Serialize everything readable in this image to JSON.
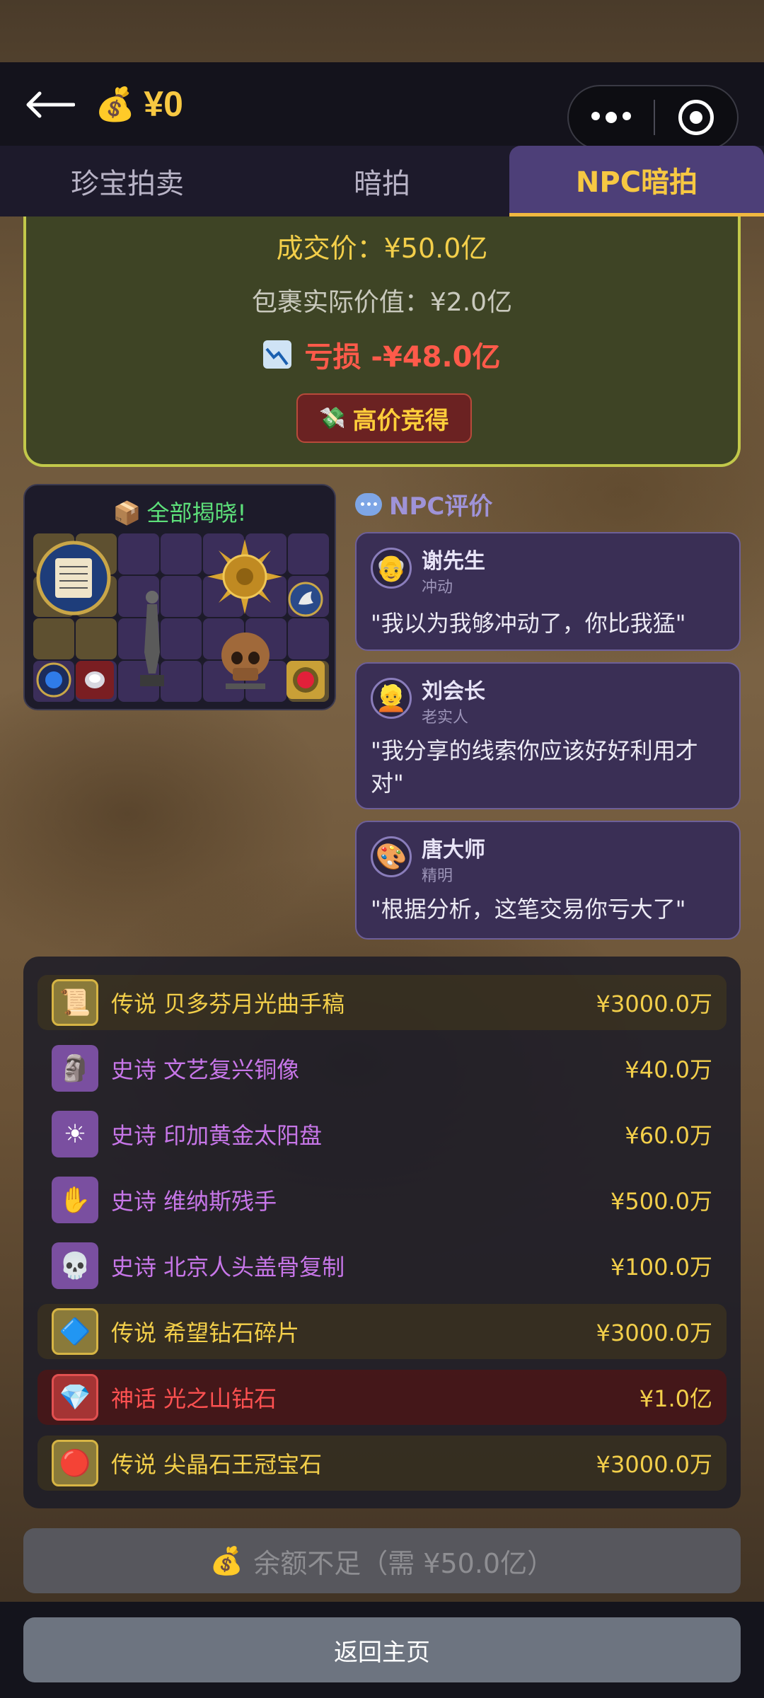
{
  "header": {
    "money_icon": "money-bag-icon",
    "balance": "¥0"
  },
  "tabs": [
    {
      "label": "珍宝拍卖",
      "active": false
    },
    {
      "label": "暗拍",
      "active": false
    },
    {
      "label": "NPC暗拍",
      "active": true
    }
  ],
  "result": {
    "deal_price": "成交价：¥50.0亿",
    "actual_value": "包裹实际价值：¥2.0亿",
    "loss_text": "亏损 -¥48.0亿",
    "badge": "高价竞得",
    "colors": {
      "loss": "#ff5a4a",
      "gold": "#f3cf4a",
      "card_border": "#c2c84a"
    }
  },
  "reveal": {
    "title": "全部揭晓!"
  },
  "npc": {
    "section_title": "NPC评价",
    "reviews": [
      {
        "name": "谢先生",
        "trait": "冲动",
        "quote": "\"我以为我够冲动了，你比我猛\"",
        "avatar": "elder-avatar-icon"
      },
      {
        "name": "刘会长",
        "trait": "老实人",
        "quote": "\"我分享的线索你应该好好利用才对\"",
        "avatar": "graduate-avatar-icon"
      },
      {
        "name": "唐大师",
        "trait": "精明",
        "quote": "\"根据分析，这笔交易你亏大了\"",
        "avatar": "artist-avatar-icon"
      }
    ]
  },
  "items": [
    {
      "rarity": "legend",
      "label": "传说 贝多芬月光曲手稿",
      "price": "¥3000.0万",
      "icon": "scroll-icon"
    },
    {
      "rarity": "epic",
      "label": "史诗 文艺复兴铜像",
      "price": "¥40.0万",
      "icon": "statue-icon"
    },
    {
      "rarity": "epic",
      "label": "史诗 印加黄金太阳盘",
      "price": "¥60.0万",
      "icon": "sun-disc-icon"
    },
    {
      "rarity": "epic",
      "label": "史诗 维纳斯残手",
      "price": "¥500.0万",
      "icon": "hand-icon"
    },
    {
      "rarity": "epic",
      "label": "史诗 北京人头盖骨复制",
      "price": "¥100.0万",
      "icon": "skull-icon"
    },
    {
      "rarity": "legend",
      "label": "传说 希望钻石碎片",
      "price": "¥3000.0万",
      "icon": "blue-gem-icon"
    },
    {
      "rarity": "myth",
      "label": "神话 光之山钻石",
      "price": "¥1.0亿",
      "icon": "diamond-icon"
    },
    {
      "rarity": "legend",
      "label": "传说 尖晶石王冠宝石",
      "price": "¥3000.0万",
      "icon": "red-gem-icon"
    }
  ],
  "actions": {
    "insufficient": "余额不足（需 ¥50.0亿）",
    "home": "返回主页"
  }
}
